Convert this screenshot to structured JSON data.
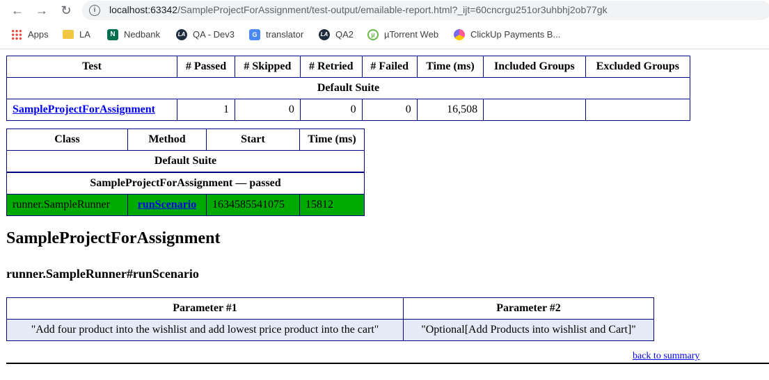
{
  "browser": {
    "url_host": "localhost:63342",
    "url_path": "/SampleProjectForAssignment/test-output/emailable-report.html?_ijt=60cncrgu251or3uhbhj2ob77gk",
    "bookmarks": [
      {
        "label": "Apps",
        "icon": "apps-icon"
      },
      {
        "label": "LA",
        "icon": "folder-icon"
      },
      {
        "label": "Nedbank",
        "icon": "nedbank-icon"
      },
      {
        "label": "QA - Dev3",
        "icon": "la-icon"
      },
      {
        "label": "translator",
        "icon": "translate-icon"
      },
      {
        "label": "QA2",
        "icon": "la-icon"
      },
      {
        "label": "µTorrent Web",
        "icon": "utorrent-icon"
      },
      {
        "label": "ClickUp Payments B...",
        "icon": "clickup-icon"
      }
    ]
  },
  "summary": {
    "headers": [
      "Test",
      "# Passed",
      "# Skipped",
      "# Retried",
      "# Failed",
      "Time (ms)",
      "Included Groups",
      "Excluded Groups"
    ],
    "suite": "Default Suite",
    "row": {
      "test": "SampleProjectForAssignment",
      "passed": "1",
      "skipped": "0",
      "retried": "0",
      "failed": "0",
      "time": "16,508",
      "included": "",
      "excluded": ""
    }
  },
  "methods": {
    "headers": [
      "Class",
      "Method",
      "Start",
      "Time (ms)"
    ],
    "suite": "Default Suite",
    "group": "SampleProjectForAssignment — passed",
    "row": {
      "class": "runner.SampleRunner",
      "method": "runScenario",
      "start": "1634585541075",
      "time": "15812"
    },
    "pass_color": "#00aa00"
  },
  "detail": {
    "title": "SampleProjectForAssignment",
    "subtitle": "runner.SampleRunner#runScenario",
    "param_headers": [
      "Parameter #1",
      "Parameter #2"
    ],
    "params": [
      "\"Add four product into the wishlist and add lowest price product into the cart\"",
      "\"Optional[Add Products into wishlist and Cart]\""
    ],
    "back_link": "back to summary"
  }
}
